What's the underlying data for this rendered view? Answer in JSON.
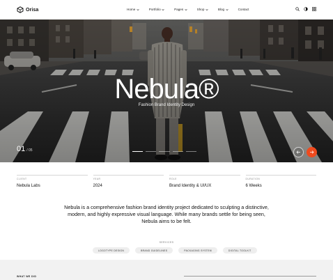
{
  "brand": {
    "name": "Orisa"
  },
  "nav": [
    {
      "label": "Home",
      "has_dropdown": true
    },
    {
      "label": "Portfolio",
      "has_dropdown": true
    },
    {
      "label": "Pages",
      "has_dropdown": true
    },
    {
      "label": "Shop",
      "has_dropdown": true
    },
    {
      "label": "Blog",
      "has_dropdown": true
    },
    {
      "label": "Contact",
      "has_dropdown": false
    }
  ],
  "header_icons": [
    "search-icon",
    "theme-toggle-icon",
    "grid-menu-icon"
  ],
  "hero": {
    "title": "Nebula®",
    "subtitle": "Fashion Brand Identity Design",
    "counter_current": "01",
    "counter_total": "/ 05",
    "slide_index": 1,
    "slide_count": 5,
    "accent_color": "#ef4a1e"
  },
  "meta": [
    {
      "label": "CLIENT",
      "value": "Nebula Labs"
    },
    {
      "label": "YEAR",
      "value": "2024"
    },
    {
      "label": "ROLE",
      "value": "Brand Identity & UI/UX"
    },
    {
      "label": "DURATION",
      "value": "6 Weeks"
    }
  ],
  "description": "Nebula is a comprehensive fashion brand identity project dedicated to sculpting a distinctive, modern, and highly expressive visual language. While many brands settle for being seen, Nebula aims to be felt.",
  "services": {
    "label": "SERVICES",
    "tags": [
      "LOGOTYPE DESIGN",
      "BRAND GUIDELINES",
      "PACKAGING SYSTEM",
      "DIGITAL TOOLKIT"
    ]
  },
  "section_label": "WHAT WE DID"
}
